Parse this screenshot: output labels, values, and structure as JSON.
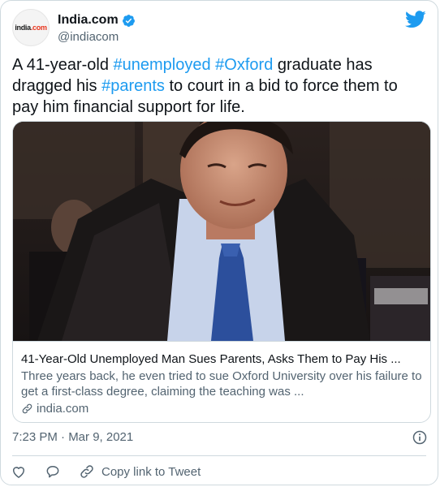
{
  "author": {
    "avatar_text": "india",
    "avatar_suffix": ".com",
    "display_name": "India.com",
    "handle": "@indiacom"
  },
  "tweet": {
    "text_parts": [
      {
        "text": "A 41-year-old ",
        "hashtag": false
      },
      {
        "text": "#unemployed",
        "hashtag": true
      },
      {
        "text": " ",
        "hashtag": false
      },
      {
        "text": "#Oxford",
        "hashtag": true
      },
      {
        "text": " graduate has dragged his ",
        "hashtag": false
      },
      {
        "text": "#parents",
        "hashtag": true
      },
      {
        "text": " to court in a bid to force them to pay him financial support for life.",
        "hashtag": false
      }
    ]
  },
  "card": {
    "title": "41-Year-Old Unemployed Man Sues Parents, Asks Them to Pay His ...",
    "description": "Three years back, he even tried to sue Oxford University over his failure to get a first-class degree, claiming the teaching was ...",
    "domain": "india.com"
  },
  "timestamp": "7:23 PM · Mar 9, 2021",
  "actions": {
    "copy_link_label": "Copy link to Tweet"
  },
  "colors": {
    "accent": "#1d9bf0",
    "text": "#0f1419",
    "secondary": "#536471",
    "border": "#cfd9de"
  },
  "icons": [
    "verified-badge-icon",
    "twitter-bird-icon",
    "link-icon",
    "info-icon",
    "like-heart-icon",
    "reply-bubble-icon",
    "copy-link-icon"
  ]
}
